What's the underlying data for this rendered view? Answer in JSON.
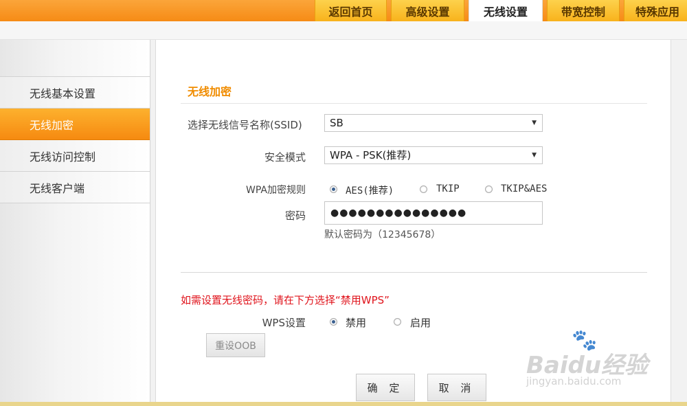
{
  "nav": {
    "tabs": [
      {
        "label": "返回首页"
      },
      {
        "label": "高级设置"
      },
      {
        "label": "无线设置"
      },
      {
        "label": "带宽控制"
      },
      {
        "label": "特殊应用"
      }
    ],
    "active_index": 2
  },
  "sidebar": {
    "items": [
      {
        "label": "无线基本设置"
      },
      {
        "label": "无线加密"
      },
      {
        "label": "无线访问控制"
      },
      {
        "label": "无线客户端"
      }
    ],
    "active_index": 1
  },
  "main": {
    "section_title": "无线加密",
    "ssid": {
      "label": "选择无线信号名称(SSID)",
      "value": "SB"
    },
    "security_mode": {
      "label": "安全模式",
      "value": "WPA - PSK(推荐)"
    },
    "wpa_rule": {
      "label": "WPA加密规则",
      "options": [
        {
          "label": "AES(推荐)",
          "selected": true
        },
        {
          "label": "TKIP",
          "selected": false
        },
        {
          "label": "TKIP&AES",
          "selected": false
        }
      ]
    },
    "password": {
      "label": "密码",
      "value": "●●●●●●●●●●●●●●●",
      "hint": "默认密码为（12345678）"
    },
    "wps_notice": "如需设置无线密码，请在下方选择“禁用WPS”",
    "wps": {
      "label": "WPS设置",
      "options": [
        {
          "label": "禁用",
          "selected": true
        },
        {
          "label": "启用",
          "selected": false
        }
      ]
    },
    "reset_oob_label": "重设OOB",
    "ok_label": "确 定",
    "cancel_label": "取 消"
  },
  "watermark": {
    "logo": "Baidu经验",
    "url": "jingyan.baidu.com"
  },
  "colors": {
    "accent": "#f68b15",
    "title": "#f08c00",
    "warning": "#e0141c",
    "radio_dot": "#3a5f8f"
  }
}
